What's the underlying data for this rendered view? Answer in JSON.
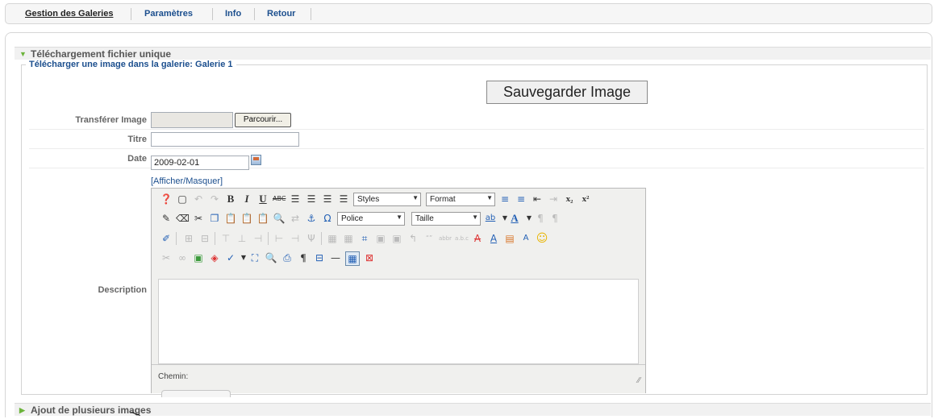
{
  "nav": {
    "items": [
      {
        "label": "Gestion des Galeries",
        "active": true
      },
      {
        "label": "Paramètres",
        "active": false
      },
      {
        "label": "Info",
        "active": false
      },
      {
        "label": "Retour",
        "active": false
      }
    ]
  },
  "single_upload": {
    "header": "Téléchargement fichier unique",
    "legend": "Télécharger une image dans la galerie: Galerie 1",
    "save_label": "Sauvegarder Image",
    "fields": {
      "file_label": "Transférer Image",
      "browse_label": "Parcourir...",
      "title_label": "Titre",
      "title_value": "",
      "date_label": "Date",
      "date_value": "2009-02-01",
      "toggle_label": "[Afficher/Masquer]",
      "description_label": "Description"
    },
    "editor": {
      "styles_value": "Styles",
      "format_value": "Format",
      "police_value": "Police",
      "taille_value": "Taille",
      "path_label": "Chemin:"
    }
  },
  "multi_upload": {
    "header": "Ajout de plusieurs images"
  },
  "colors": {
    "link": "#1c4f8e",
    "expand_arrow": "#6bb33a"
  }
}
